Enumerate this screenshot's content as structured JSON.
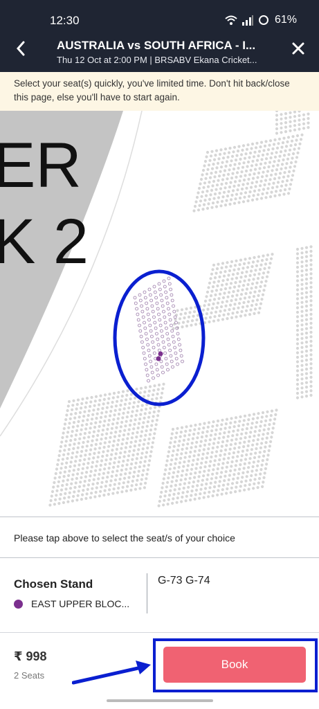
{
  "status_bar": {
    "time": "12:30",
    "battery": "61%",
    "icons": [
      "wifi-icon",
      "signal-icon",
      "battery-icon"
    ]
  },
  "header": {
    "title": "AUSTRALIA vs SOUTH AFRICA - I...",
    "subtitle": "Thu 12 Oct at 2:00 PM | BRSABV Ekana Cricket...",
    "back_icon": "chevron-left-icon",
    "close_icon": "close-icon"
  },
  "warning": {
    "text": "Select your seat(s) quickly, you've limited time. Don't hit back/close this page, else you'll have to start again."
  },
  "seat_map": {
    "block_label_lines": [
      "ER",
      "K 2"
    ],
    "selected_seat_color": "#7b2f8e",
    "highlight_color": "#0a1fd0"
  },
  "instruction": {
    "text": "Please tap above to select the seat/s of your choice"
  },
  "chosen_stand": {
    "label": "Chosen Stand",
    "stand_name": "EAST UPPER BLOC...",
    "seats": "G-73 G-74",
    "stand_color": "#7b2f8e"
  },
  "footer": {
    "price": "₹ 998",
    "seat_count": "2 Seats",
    "book_label": "Book",
    "book_color": "#f06272"
  }
}
